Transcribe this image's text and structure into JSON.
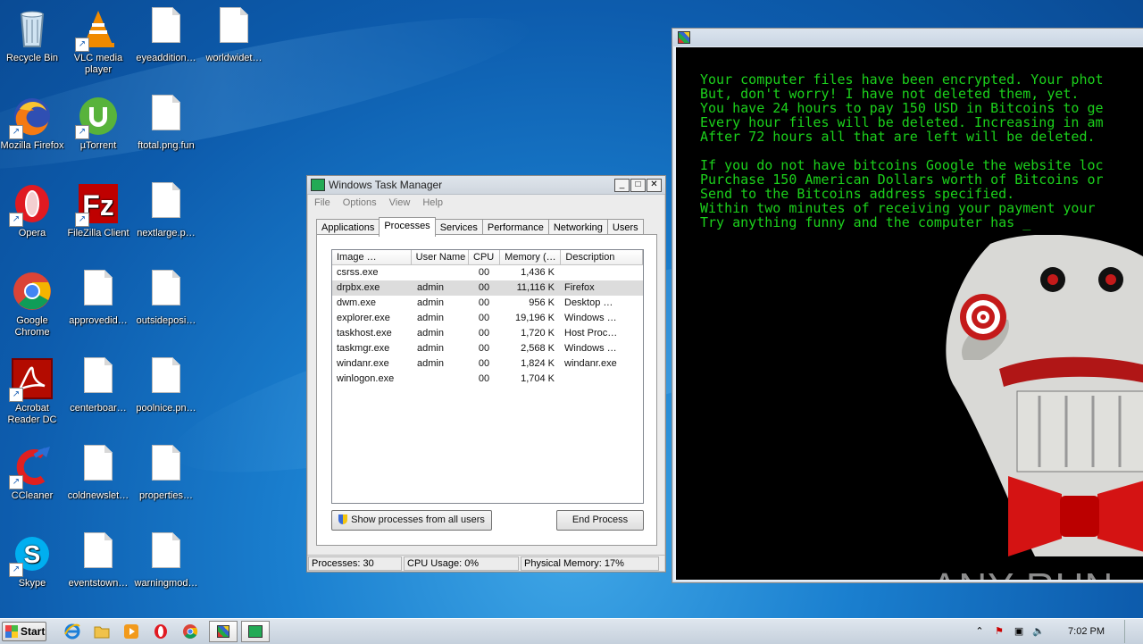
{
  "desktop": {
    "icons": [
      {
        "label": "Recycle Bin",
        "icon": "recycle-bin-icon"
      },
      {
        "label": "VLC media player",
        "icon": "vlc-icon"
      },
      {
        "label": "eyeaddition…",
        "icon": "file-icon"
      },
      {
        "label": "worldwidet…",
        "icon": "file-icon"
      },
      {
        "label": "Mozilla Firefox",
        "icon": "firefox-icon"
      },
      {
        "label": "µTorrent",
        "icon": "utorrent-icon"
      },
      {
        "label": "ftotal.png.fun",
        "icon": "file-icon"
      },
      {
        "label": "Opera",
        "icon": "opera-icon"
      },
      {
        "label": "FileZilla Client",
        "icon": "filezilla-icon"
      },
      {
        "label": "nextlarge.p…",
        "icon": "file-icon"
      },
      {
        "label": "Google Chrome",
        "icon": "chrome-icon"
      },
      {
        "label": "approvedid…",
        "icon": "file-icon"
      },
      {
        "label": "outsideposi…",
        "icon": "file-icon"
      },
      {
        "label": "Acrobat Reader DC",
        "icon": "acrobat-icon"
      },
      {
        "label": "centerboar…",
        "icon": "file-icon"
      },
      {
        "label": "poolnice.pn…",
        "icon": "file-icon"
      },
      {
        "label": "CCleaner",
        "icon": "ccleaner-icon"
      },
      {
        "label": "coldnewslet…",
        "icon": "file-icon"
      },
      {
        "label": "properties…",
        "icon": "file-icon"
      },
      {
        "label": "Skype",
        "icon": "skype-icon"
      },
      {
        "label": "eventstown…",
        "icon": "file-icon"
      },
      {
        "label": "warningmod…",
        "icon": "file-icon"
      }
    ]
  },
  "task_manager": {
    "title": "Windows Task Manager",
    "menu": [
      "File",
      "Options",
      "View",
      "Help"
    ],
    "tabs": [
      "Applications",
      "Processes",
      "Services",
      "Performance",
      "Networking",
      "Users"
    ],
    "active_tab": "Processes",
    "columns": [
      "Image …",
      "User Name",
      "CPU",
      "Memory (…",
      "Description"
    ],
    "rows": [
      {
        "image": "csrss.exe",
        "user": "",
        "cpu": "00",
        "memory": "1,436 K",
        "desc": ""
      },
      {
        "image": "drpbx.exe",
        "user": "admin",
        "cpu": "00",
        "memory": "11,116 K",
        "desc": "Firefox"
      },
      {
        "image": "dwm.exe",
        "user": "admin",
        "cpu": "00",
        "memory": "956 K",
        "desc": "Desktop …"
      },
      {
        "image": "explorer.exe",
        "user": "admin",
        "cpu": "00",
        "memory": "19,196 K",
        "desc": "Windows …"
      },
      {
        "image": "taskhost.exe",
        "user": "admin",
        "cpu": "00",
        "memory": "1,720 K",
        "desc": "Host Proc…"
      },
      {
        "image": "taskmgr.exe",
        "user": "admin",
        "cpu": "00",
        "memory": "2,568 K",
        "desc": "Windows …"
      },
      {
        "image": "windanr.exe",
        "user": "admin",
        "cpu": "00",
        "memory": "1,824 K",
        "desc": "windanr.exe"
      },
      {
        "image": "winlogon.exe",
        "user": "",
        "cpu": "00",
        "memory": "1,704 K",
        "desc": ""
      }
    ],
    "show_all_label": "Show processes from all users",
    "end_process_label": "End Process",
    "status": {
      "processes": "Processes: 30",
      "cpu": "CPU Usage: 0%",
      "memory": "Physical Memory: 17%"
    }
  },
  "ransom_window": {
    "lines": [
      "Your computer files have been encrypted. Your phot",
      "But, don't worry! I have not deleted them, yet.",
      "You have 24 hours to pay 150 USD in Bitcoins to ge",
      "Every hour files will be deleted. Increasing in am",
      "After 72 hours all that are left will be deleted.",
      "",
      "If you do not have bitcoins Google the website loc",
      "Purchase 150 American Dollars worth of Bitcoins or",
      "Send to the Bitcoins address specified.",
      "Within two minutes of receiving your payment your",
      "Try anything funny and the computer has _"
    ],
    "watermark": "ANY RUN"
  },
  "taskbar": {
    "start_label": "Start",
    "clock": "7:02 PM"
  }
}
